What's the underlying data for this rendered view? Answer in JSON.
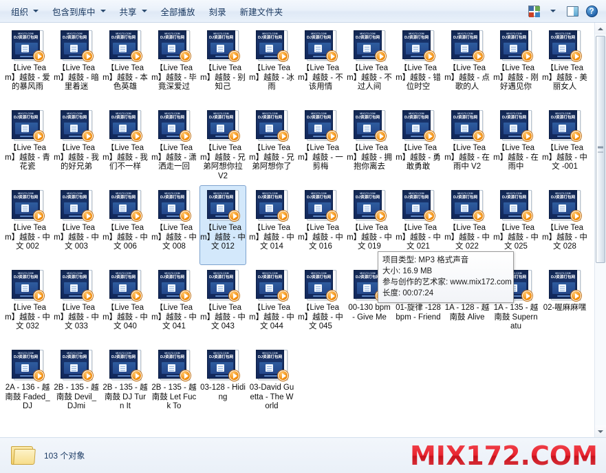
{
  "toolbar": {
    "buttons": [
      {
        "label": "组织",
        "has_caret": true
      },
      {
        "label": "包含到库中",
        "has_caret": true
      },
      {
        "label": "共享",
        "has_caret": true
      },
      {
        "label": "全部播放",
        "has_caret": false
      },
      {
        "label": "刻录",
        "has_caret": false
      },
      {
        "label": "新建文件夹",
        "has_caret": false
      }
    ],
    "views_icon": "views-icon",
    "views_caret_icon": "chevron-down-icon",
    "preview_pane_icon": "preview-pane-icon",
    "help_icon": "help-icon"
  },
  "thumbnail": {
    "brand_top": "MIX172.COM",
    "brand_main": "DJ资源打包网",
    "badge_icon": "play-badge-icon"
  },
  "files": [
    {
      "name": "【Live Team】越鼓 - 爱的暴风雨",
      "selected": false
    },
    {
      "name": "【Live Team】越鼓 - 暗里着迷",
      "selected": false
    },
    {
      "name": "【Live Team】越鼓 - 本色英雄",
      "selected": false
    },
    {
      "name": "【Live Team】越鼓 - 毕竟深爱过",
      "selected": false
    },
    {
      "name": "【Live Team】越鼓 - 别知己",
      "selected": false
    },
    {
      "name": "【Live Team】越鼓 - 冰雨",
      "selected": false
    },
    {
      "name": "【Live Team】越鼓 - 不该用情",
      "selected": false
    },
    {
      "name": "【Live Team】越鼓 - 不过人间",
      "selected": false
    },
    {
      "name": "【Live Team】越鼓 - 错位时空",
      "selected": false
    },
    {
      "name": "【Live Team】越鼓 - 点歌的人",
      "selected": false
    },
    {
      "name": "【Live Team】越鼓 - 刚好遇见你",
      "selected": false
    },
    {
      "name": "【Live Team】越鼓 - 美丽女人",
      "selected": false
    },
    {
      "name": "【Live Team】越鼓 - 青花瓷",
      "selected": false
    },
    {
      "name": "【Live Team】越鼓 - 我的好兄弟",
      "selected": false
    },
    {
      "name": "【Live Team】越鼓 - 我们不一样",
      "selected": false
    },
    {
      "name": "【Live Team】越鼓 - 潇洒走一回",
      "selected": false
    },
    {
      "name": "【Live Team】越鼓 - 兄弟阿想你拉 V2",
      "selected": false
    },
    {
      "name": "【Live Team】越鼓 - 兄弟阿想你了",
      "selected": false
    },
    {
      "name": "【Live Team】越鼓 - 一剪梅",
      "selected": false
    },
    {
      "name": "【Live Team】越鼓 - 拥抱你离去",
      "selected": false
    },
    {
      "name": "【Live Team】越鼓 - 勇敢勇敢",
      "selected": false
    },
    {
      "name": "【Live Team】越鼓 - 在雨中 V2",
      "selected": false
    },
    {
      "name": "【Live Team】越鼓 - 在雨中",
      "selected": false
    },
    {
      "name": "【Live Team】越鼓 - 中文 -001",
      "selected": false
    },
    {
      "name": "【Live Team】越鼓 - 中文 002",
      "selected": false
    },
    {
      "name": "【Live Team】越鼓 - 中文 003",
      "selected": false
    },
    {
      "name": "【Live Team】越鼓 - 中文 006",
      "selected": false
    },
    {
      "name": "【Live Team】越鼓 - 中文 008",
      "selected": false
    },
    {
      "name": "【Live Team】越鼓 - 中文 012",
      "selected": true
    },
    {
      "name": "【Live Team】越鼓 - 中文 014",
      "selected": false
    },
    {
      "name": "【Live Team】越鼓 - 中文 016",
      "selected": false
    },
    {
      "name": "【Live Team】越鼓 - 中文 019",
      "selected": false
    },
    {
      "name": "【Live Team】越鼓 - 中文 021",
      "selected": false
    },
    {
      "name": "【Live Team】越鼓 - 中文 022",
      "selected": false
    },
    {
      "name": "【Live Team】越鼓 - 中文 025",
      "selected": false
    },
    {
      "name": "【Live Team】越鼓 - 中文 028",
      "selected": false
    },
    {
      "name": "【Live Team】越鼓 - 中文 032",
      "selected": false
    },
    {
      "name": "【Live Team】越鼓 - 中文 033",
      "selected": false
    },
    {
      "name": "【Live Team】越鼓 - 中文 040",
      "selected": false
    },
    {
      "name": "【Live Team】越鼓 - 中文 041",
      "selected": false
    },
    {
      "name": "【Live Team】越鼓 - 中文 043",
      "selected": false
    },
    {
      "name": "【Live Team】越鼓 - 中文 044",
      "selected": false
    },
    {
      "name": "【Live Team】越鼓 - 中文 045",
      "selected": false
    },
    {
      "name": "00-130 bpm - Give Me",
      "selected": false
    },
    {
      "name": "01-旋律 -128 bpm - Friend",
      "selected": false
    },
    {
      "name": "1A - 128 - 越南鼓 Alive",
      "selected": false
    },
    {
      "name": "1A - 135 - 越南鼓 Supernatu",
      "selected": false
    },
    {
      "name": "02-喔麻麻嘿",
      "selected": false
    },
    {
      "name": "2A - 136 - 越南鼓 Faded_DJ",
      "selected": false
    },
    {
      "name": "2B - 135 - 越南鼓 Devil_DJmi",
      "selected": false
    },
    {
      "name": "2B - 135 - 越南鼓 DJ Turn It",
      "selected": false
    },
    {
      "name": "2B - 135 - 越南鼓 Let Fuck To",
      "selected": false
    },
    {
      "name": "03-128 - Hiding",
      "selected": false
    },
    {
      "name": "03-David Guetta - The World",
      "selected": false
    }
  ],
  "tooltip": {
    "type_line": "项目类型: MP3 格式声音",
    "size_line": "大小: 16.9 MB",
    "artist_line": "参与创作的艺术家: www.mix172.com",
    "length_line": "长度: 00:07:24"
  },
  "statusbar": {
    "folder_icon": "folder-icon",
    "item_count": "103 个对象",
    "watermark": "MIX172.COM"
  }
}
